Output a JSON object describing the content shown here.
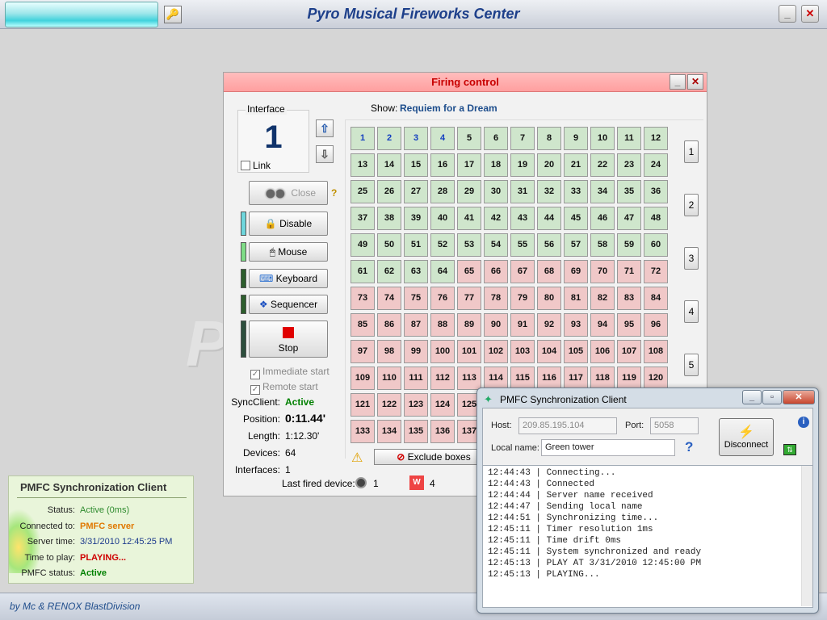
{
  "app": {
    "title": "Pyro Musical Fireworks Center",
    "footer": "by Mc & RENOX BlastDivision",
    "watermark": "P",
    "minimize": "_",
    "close": "✕"
  },
  "firing": {
    "title": "Firing control",
    "interface_label": "Interface",
    "interface_number": "1",
    "link_label": "Link",
    "close_label": "Close",
    "help_icon": "?",
    "disable_label": "Disable",
    "mouse_label": "Mouse",
    "keyboard_label": "Keyboard",
    "sequencer_label": "Sequencer",
    "stop_label": "Stop",
    "immediate_start": "Immediate start",
    "remote_start": "Remote start",
    "show_label": "Show:",
    "show_value": "Requiem for a Dream",
    "info": [
      {
        "label": "SyncClient:",
        "value": "Active",
        "color": "#008000"
      },
      {
        "label": "Position:",
        "value": "0:11.44'",
        "color": "#000000"
      },
      {
        "label": "Length:",
        "value": "1:12.30'",
        "color": "#000000"
      },
      {
        "label": "Devices:",
        "value": "64",
        "color": "#000000"
      },
      {
        "label": "Interfaces:",
        "value": "1",
        "color": "#000000"
      }
    ],
    "exclude_label": "Exclude boxes",
    "last_fired_label": "Last fired device:",
    "last_fired_1": "1",
    "last_fired_2": "4",
    "group_buttons": [
      "1",
      "2",
      "3",
      "4",
      "5"
    ],
    "grid": {
      "green_until": 64,
      "blue_cells": [
        1,
        2,
        3,
        4
      ],
      "visible_rows": [
        {
          "y": 0,
          "start": 1
        },
        {
          "y": 1,
          "start": 13
        },
        {
          "y": 2,
          "start": 25
        },
        {
          "y": 3,
          "start": 37
        },
        {
          "y": 4,
          "start": 49
        },
        {
          "y": 5,
          "start": 61
        },
        {
          "y": 6,
          "start": 73
        },
        {
          "y": 7,
          "start": 85
        },
        {
          "y": 8,
          "start": 97
        },
        {
          "y": 9,
          "start": 109
        },
        {
          "y": 10,
          "start": 121
        },
        {
          "y": 11,
          "start": 133
        }
      ]
    }
  },
  "status_panel": {
    "title": "PMFC Synchronization Client",
    "rows": [
      {
        "label": "Status:",
        "value": "Active (0ms)",
        "color": "#2e8b2e",
        "bold": false
      },
      {
        "label": "Connected to:",
        "value": "PMFC server",
        "color": "#e07800",
        "bold": true
      },
      {
        "label": "Server time:",
        "value": "3/31/2010 12:45:25 PM",
        "color": "#1c3a8c",
        "bold": false
      },
      {
        "label": "Time to play:",
        "value": "PLAYING...",
        "color": "#d00000",
        "bold": true
      },
      {
        "label": "PMFC status:",
        "value": "Active",
        "color": "#008000",
        "bold": true
      }
    ]
  },
  "sync_client": {
    "title": "PMFC Synchronization Client",
    "host_label": "Host:",
    "host_value": "209.85.195.104",
    "port_label": "Port:",
    "port_value": "5058",
    "local_name_label": "Local name:",
    "local_name_value": "Green tower",
    "disconnect_label": "Disconnect",
    "log": [
      "12:44:43 | Connecting...",
      "12:44:43 | Connected",
      "12:44:44 | Server name received",
      "12:44:47 | Sending local name",
      "12:44:51 | Synchronizing time...",
      "12:45:11 | Timer resolution 1ms",
      "12:45:11 | Time drift 0ms",
      "12:45:11 | System synchronized and ready",
      "12:45:13 | PLAY AT 3/31/2010 12:45:00 PM",
      "12:45:13 | PLAYING..."
    ]
  }
}
